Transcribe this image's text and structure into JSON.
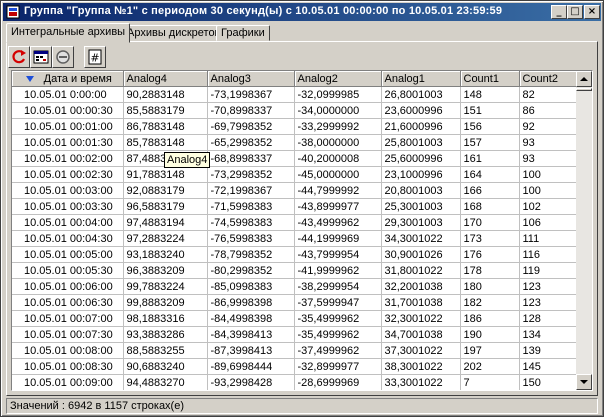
{
  "window": {
    "title": "Группа \"Группа №1\" с периодом 30 секунд(ы) с 10.05.01 00:00:00 по 10.05.01 23:59:59",
    "minimize": "_",
    "maximize": "□",
    "close": "×"
  },
  "tabs": [
    {
      "label": "Интегральные архивы",
      "active": true
    },
    {
      "label": "Архивы дискретов",
      "active": false
    },
    {
      "label": "Графики",
      "active": false
    }
  ],
  "toolbar": {
    "refresh_icon": "refresh-icon",
    "calendar_icon": "calendar-icon",
    "minus_icon": "minus-circle-icon",
    "hash_icon": "hash-icon",
    "hash_glyph": "#"
  },
  "table": {
    "columns": [
      "Дата и время",
      "Analog4",
      "Analog3",
      "Analog2",
      "Analog1",
      "Count1",
      "Count2"
    ],
    "rows": [
      [
        "10.05.01 0:00:00",
        "90,2883148",
        "-73,1998367",
        "-32,0999985",
        "26,8001003",
        "148",
        "82"
      ],
      [
        "10.05.01 00:00:30",
        "85,5883179",
        "-70,8998337",
        "-34,0000000",
        "23,6000996",
        "151",
        "86"
      ],
      [
        "10.05.01 00:01:00",
        "86,7883148",
        "-69,7998352",
        "-33,2999992",
        "21,6000996",
        "156",
        "92"
      ],
      [
        "10.05.01 00:01:30",
        "85,7883148",
        "-65,2998352",
        "-38,0000000",
        "25,8001003",
        "157",
        "93"
      ],
      [
        "10.05.01 00:02:00",
        "87,4883",
        "-68,8998337",
        "-40,2000008",
        "25,6000996",
        "161",
        "93"
      ],
      [
        "10.05.01 00:02:30",
        "91,7883148",
        "-73,2998352",
        "-45,0000000",
        "23,1000996",
        "164",
        "100"
      ],
      [
        "10.05.01 00:03:00",
        "92,0883179",
        "-72,1998367",
        "-44,7999992",
        "20,8001003",
        "166",
        "100"
      ],
      [
        "10.05.01 00:03:30",
        "96,5883179",
        "-71,5998383",
        "-43,8999977",
        "25,3001003",
        "168",
        "102"
      ],
      [
        "10.05.01 00:04:00",
        "97,4883194",
        "-74,5998383",
        "-43,4999962",
        "29,3001003",
        "170",
        "106"
      ],
      [
        "10.05.01 00:04:30",
        "97,2883224",
        "-76,5998383",
        "-44,1999969",
        "34,3001022",
        "173",
        "111"
      ],
      [
        "10.05.01 00:05:00",
        "93,1883240",
        "-78,7998352",
        "-43,7999954",
        "30,9001026",
        "176",
        "116"
      ],
      [
        "10.05.01 00:05:30",
        "96,3883209",
        "-80,2998352",
        "-41,9999962",
        "31,8001022",
        "178",
        "119"
      ],
      [
        "10.05.01 00:06:00",
        "99,7883224",
        "-85,0998383",
        "-38,2999954",
        "32,2001038",
        "180",
        "123"
      ],
      [
        "10.05.01 00:06:30",
        "99,8883209",
        "-86,9998398",
        "-37,5999947",
        "31,7001038",
        "182",
        "123"
      ],
      [
        "10.05.01 00:07:00",
        "98,1883316",
        "-84,4998398",
        "-35,4999962",
        "32,3001022",
        "186",
        "128"
      ],
      [
        "10.05.01 00:07:30",
        "93,3883286",
        "-84,3998413",
        "-35,4999962",
        "34,7001038",
        "190",
        "134"
      ],
      [
        "10.05.01 00:08:00",
        "88,5883255",
        "-87,3998413",
        "-37,4999962",
        "37,3001022",
        "197",
        "139"
      ],
      [
        "10.05.01 00:08:30",
        "90,6883240",
        "-89,6998444",
        "-32,8999977",
        "38,3001022",
        "202",
        "145"
      ],
      [
        "10.05.01 00:09:00",
        "94,4883270",
        "-93,2998428",
        "-28,6999969",
        "33,3001022",
        "7",
        "150"
      ],
      [
        "10.05.01 00:09:30",
        "94,7883301",
        "-97,2998428",
        "-27,5999966",
        "33,1001015",
        "8",
        "152"
      ]
    ]
  },
  "tooltip": "Analog4",
  "status": "Значений : 6942 в 1157 строках(е)",
  "colors": {
    "titlebar_start": "#0a246a",
    "titlebar_end": "#3a6ea5",
    "sort_arrow": "#1e4fd8"
  }
}
